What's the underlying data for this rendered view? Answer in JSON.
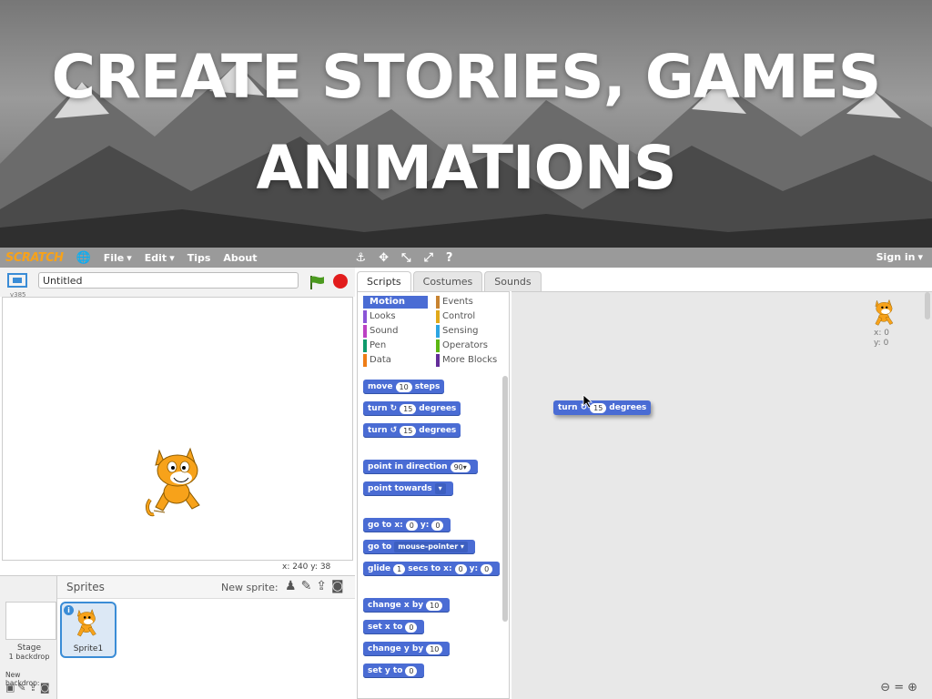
{
  "banner": {
    "line1": "CREATE STORIES, GAMES",
    "line2": "ANIMATIONS"
  },
  "menubar": {
    "logo": "SCRATCH",
    "items": [
      "File",
      "Edit",
      "Tips",
      "About"
    ],
    "sign_in": "Sign in"
  },
  "stage": {
    "version": "v385",
    "project_title": "Untitled",
    "coords": "x: 240  y: 38"
  },
  "sprites": {
    "header": "Sprites",
    "new_sprite": "New sprite:",
    "stage_label": "Stage",
    "backdrop_count": "1 backdrop",
    "new_backdrop": "New backdrop:",
    "sprite_name": "Sprite1"
  },
  "tabs": [
    "Scripts",
    "Costumes",
    "Sounds"
  ],
  "categories": {
    "left": [
      "Motion",
      "Looks",
      "Sound",
      "Pen",
      "Data"
    ],
    "right": [
      "Events",
      "Control",
      "Sensing",
      "Operators",
      "More Blocks"
    ],
    "colors_left": [
      "#4a6cd4",
      "#8a55d7",
      "#bb42c3",
      "#0e9a6c",
      "#ee7d16"
    ],
    "colors_right": [
      "#c88330",
      "#e1a91a",
      "#2ca5e2",
      "#5cb712",
      "#632d99"
    ]
  },
  "blocks": {
    "move": {
      "pre": "move",
      "val": "10",
      "post": "steps"
    },
    "turn_cw": {
      "pre": "turn",
      "val": "15",
      "post": "degrees"
    },
    "turn_ccw": {
      "pre": "turn",
      "val": "15",
      "post": "degrees"
    },
    "point_dir": {
      "pre": "point in direction",
      "val": "90▾"
    },
    "point_towards": {
      "pre": "point towards",
      "val": "▾"
    },
    "goto_xy": {
      "pre": "go to x:",
      "x": "0",
      "mid": "y:",
      "y": "0"
    },
    "goto": {
      "pre": "go to",
      "val": "mouse-pointer ▾"
    },
    "glide": {
      "pre": "glide",
      "secs": "1",
      "mid": "secs to x:",
      "x": "0",
      "ylbl": "y:",
      "y": "0"
    },
    "change_x": {
      "pre": "change x by",
      "val": "10"
    },
    "set_x": {
      "pre": "set x to",
      "val": "0"
    },
    "change_y": {
      "pre": "change y by",
      "val": "10"
    },
    "set_y": {
      "pre": "set y to",
      "val": "0"
    }
  },
  "script_area": {
    "dragged_block": {
      "pre": "turn",
      "val": "15",
      "post": "degrees"
    },
    "sprite_x": "x: 0",
    "sprite_y": "y: 0"
  },
  "icons": [
    "anchor-icon",
    "move-arrows-icon",
    "shrink-icon",
    "grow-icon",
    "help-icon",
    "globe-icon",
    "green-flag-icon",
    "stop-icon",
    "zoom-out-icon",
    "zoom-reset-icon",
    "zoom-in-icon"
  ]
}
